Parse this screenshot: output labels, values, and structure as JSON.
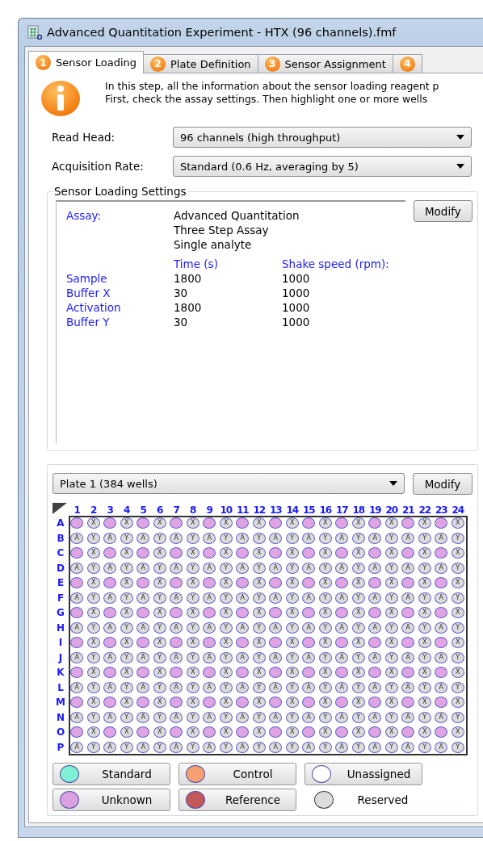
{
  "window": {
    "title": "Advanced Quantitation Experiment - HTX (96 channels).fmf"
  },
  "tabs": [
    {
      "number": "1",
      "label": "Sensor Loading",
      "selected": true
    },
    {
      "number": "2",
      "label": "Plate Definition",
      "selected": false
    },
    {
      "number": "3",
      "label": "Sensor Assignment",
      "selected": false
    },
    {
      "number": "4",
      "selected": false
    }
  ],
  "info": {
    "lines": [
      "In this step, all the information about the sensor loading reagent p",
      "First, check the assay settings. Then highlight one or more wells"
    ]
  },
  "settings": [
    {
      "label": "Read Head:",
      "value": "96 channels (high throughput)"
    },
    {
      "label": "Acquisition Rate:",
      "value": "Standard (0.6 Hz, averaging by 5)"
    }
  ],
  "sensor_loading_settings": {
    "title": "Sensor Loading Settings",
    "assay_label": "Assay:",
    "assay_lines": [
      "Advanced Quantitation",
      "Three Step Assay",
      "Single analyte"
    ],
    "columns": [
      "Time (s)",
      "Shake speed (rpm):"
    ],
    "steps": [
      {
        "name": "Sample",
        "time": "1800",
        "shake": "1000"
      },
      {
        "name": "Buffer X",
        "time": "30",
        "shake": "1000"
      },
      {
        "name": "Activation",
        "time": "1800",
        "shake": "1000"
      },
      {
        "name": "Buffer Y",
        "time": "30",
        "shake": "1000"
      }
    ],
    "button": "Modify"
  },
  "plate": {
    "selector": "Plate 1 (384 wells)",
    "button": "Modify",
    "columns": [
      "1",
      "2",
      "3",
      "4",
      "5",
      "6",
      "7",
      "8",
      "9",
      "10",
      "11",
      "12",
      "13",
      "14",
      "15",
      "16",
      "17",
      "18",
      "19",
      "20",
      "21",
      "22",
      "23",
      "24"
    ],
    "rows": [
      {
        "label": "A",
        "wells": [
          {
            "kind": "unknown"
          },
          {
            "kind": "reserved",
            "label": "X"
          },
          {
            "kind": "unknown"
          },
          {
            "kind": "reserved",
            "label": "X"
          },
          {
            "kind": "unknown"
          },
          {
            "kind": "reserved",
            "label": "X"
          },
          {
            "kind": "unknown"
          },
          {
            "kind": "reserved",
            "label": "X"
          },
          {
            "kind": "unknown"
          },
          {
            "kind": "reserved",
            "label": "X"
          },
          {
            "kind": "unknown"
          },
          {
            "kind": "reserved",
            "label": "X"
          },
          {
            "kind": "unknown"
          },
          {
            "kind": "reserved",
            "label": "X"
          },
          {
            "kind": "unknown"
          },
          {
            "kind": "reserved",
            "label": "X"
          },
          {
            "kind": "unknown"
          },
          {
            "kind": "reserved",
            "label": "X"
          },
          {
            "kind": "unknown"
          },
          {
            "kind": "reserved",
            "label": "X"
          },
          {
            "kind": "unknown"
          },
          {
            "kind": "reserved",
            "label": "X"
          },
          {
            "kind": "unknown"
          },
          {
            "kind": "reserved",
            "label": "X"
          }
        ]
      },
      {
        "label": "B",
        "wells": [
          {
            "kind": "reserved",
            "label": "A"
          },
          {
            "kind": "reserved",
            "label": "Y"
          },
          {
            "kind": "reserved",
            "label": "A"
          },
          {
            "kind": "reserved",
            "label": "Y"
          },
          {
            "kind": "reserved",
            "label": "A"
          },
          {
            "kind": "reserved",
            "label": "Y"
          },
          {
            "kind": "reserved",
            "label": "A"
          },
          {
            "kind": "reserved",
            "label": "Y"
          },
          {
            "kind": "reserved",
            "label": "A"
          },
          {
            "kind": "reserved",
            "label": "Y"
          },
          {
            "kind": "reserved",
            "label": "A"
          },
          {
            "kind": "reserved",
            "label": "Y"
          },
          {
            "kind": "reserved",
            "label": "A"
          },
          {
            "kind": "reserved",
            "label": "Y"
          },
          {
            "kind": "reserved",
            "label": "A"
          },
          {
            "kind": "reserved",
            "label": "Y"
          },
          {
            "kind": "reserved",
            "label": "A"
          },
          {
            "kind": "reserved",
            "label": "Y"
          },
          {
            "kind": "reserved",
            "label": "A"
          },
          {
            "kind": "reserved",
            "label": "Y"
          },
          {
            "kind": "reserved",
            "label": "A"
          },
          {
            "kind": "reserved",
            "label": "Y"
          },
          {
            "kind": "reserved",
            "label": "A"
          },
          {
            "kind": "reserved",
            "label": "Y"
          }
        ]
      },
      {
        "label": "C",
        "wells": [
          {
            "kind": "unknown"
          },
          {
            "kind": "reserved",
            "label": "X"
          },
          {
            "kind": "unknown"
          },
          {
            "kind": "reserved",
            "label": "X"
          },
          {
            "kind": "unknown"
          },
          {
            "kind": "reserved",
            "label": "X"
          },
          {
            "kind": "unknown"
          },
          {
            "kind": "reserved",
            "label": "X"
          },
          {
            "kind": "unknown"
          },
          {
            "kind": "reserved",
            "label": "X"
          },
          {
            "kind": "unknown"
          },
          {
            "kind": "reserved",
            "label": "X"
          },
          {
            "kind": "unknown"
          },
          {
            "kind": "reserved",
            "label": "X"
          },
          {
            "kind": "unknown"
          },
          {
            "kind": "reserved",
            "label": "X"
          },
          {
            "kind": "unknown"
          },
          {
            "kind": "reserved",
            "label": "X"
          },
          {
            "kind": "unknown"
          },
          {
            "kind": "reserved",
            "label": "X"
          },
          {
            "kind": "unknown"
          },
          {
            "kind": "reserved",
            "label": "X"
          },
          {
            "kind": "unknown"
          },
          {
            "kind": "reserved",
            "label": "X"
          }
        ]
      },
      {
        "label": "D",
        "wells": [
          {
            "kind": "reserved",
            "label": "A"
          },
          {
            "kind": "reserved",
            "label": "Y"
          },
          {
            "kind": "reserved",
            "label": "A"
          },
          {
            "kind": "reserved",
            "label": "Y"
          },
          {
            "kind": "reserved",
            "label": "A"
          },
          {
            "kind": "reserved",
            "label": "Y"
          },
          {
            "kind": "reserved",
            "label": "A"
          },
          {
            "kind": "reserved",
            "label": "Y"
          },
          {
            "kind": "reserved",
            "label": "A"
          },
          {
            "kind": "reserved",
            "label": "Y"
          },
          {
            "kind": "reserved",
            "label": "A"
          },
          {
            "kind": "reserved",
            "label": "Y"
          },
          {
            "kind": "reserved",
            "label": "A"
          },
          {
            "kind": "reserved",
            "label": "Y"
          },
          {
            "kind": "reserved",
            "label": "A"
          },
          {
            "kind": "reserved",
            "label": "Y"
          },
          {
            "kind": "reserved",
            "label": "A"
          },
          {
            "kind": "reserved",
            "label": "Y"
          },
          {
            "kind": "reserved",
            "label": "A"
          },
          {
            "kind": "reserved",
            "label": "Y"
          },
          {
            "kind": "reserved",
            "label": "A"
          },
          {
            "kind": "reserved",
            "label": "Y"
          },
          {
            "kind": "reserved",
            "label": "A"
          },
          {
            "kind": "reserved",
            "label": "Y"
          }
        ]
      },
      {
        "label": "E",
        "wells": [
          {
            "kind": "unknown"
          },
          {
            "kind": "reserved",
            "label": "X"
          },
          {
            "kind": "unknown"
          },
          {
            "kind": "reserved",
            "label": "X"
          },
          {
            "kind": "unknown"
          },
          {
            "kind": "reserved",
            "label": "X"
          },
          {
            "kind": "unknown"
          },
          {
            "kind": "reserved",
            "label": "X"
          },
          {
            "kind": "unknown"
          },
          {
            "kind": "reserved",
            "label": "X"
          },
          {
            "kind": "unknown"
          },
          {
            "kind": "reserved",
            "label": "X"
          },
          {
            "kind": "unknown"
          },
          {
            "kind": "reserved",
            "label": "X"
          },
          {
            "kind": "unknown"
          },
          {
            "kind": "reserved",
            "label": "X"
          },
          {
            "kind": "unknown"
          },
          {
            "kind": "reserved",
            "label": "X"
          },
          {
            "kind": "unknown"
          },
          {
            "kind": "reserved",
            "label": "X"
          },
          {
            "kind": "unknown"
          },
          {
            "kind": "reserved",
            "label": "X"
          },
          {
            "kind": "unknown"
          },
          {
            "kind": "reserved",
            "label": "X"
          }
        ]
      },
      {
        "label": "F",
        "wells": [
          {
            "kind": "reserved",
            "label": "A"
          },
          {
            "kind": "reserved",
            "label": "Y"
          },
          {
            "kind": "reserved",
            "label": "A"
          },
          {
            "kind": "reserved",
            "label": "Y"
          },
          {
            "kind": "reserved",
            "label": "A"
          },
          {
            "kind": "reserved",
            "label": "Y"
          },
          {
            "kind": "reserved",
            "label": "A"
          },
          {
            "kind": "reserved",
            "label": "Y"
          },
          {
            "kind": "reserved",
            "label": "A"
          },
          {
            "kind": "reserved",
            "label": "Y"
          },
          {
            "kind": "reserved",
            "label": "A"
          },
          {
            "kind": "reserved",
            "label": "Y"
          },
          {
            "kind": "reserved",
            "label": "A"
          },
          {
            "kind": "reserved",
            "label": "Y"
          },
          {
            "kind": "reserved",
            "label": "A"
          },
          {
            "kind": "reserved",
            "label": "Y"
          },
          {
            "kind": "reserved",
            "label": "A"
          },
          {
            "kind": "reserved",
            "label": "Y"
          },
          {
            "kind": "reserved",
            "label": "A"
          },
          {
            "kind": "reserved",
            "label": "Y"
          },
          {
            "kind": "reserved",
            "label": "A"
          },
          {
            "kind": "reserved",
            "label": "Y"
          },
          {
            "kind": "reserved",
            "label": "A"
          },
          {
            "kind": "reserved",
            "label": "Y"
          }
        ]
      },
      {
        "label": "G",
        "wells": [
          {
            "kind": "unknown"
          },
          {
            "kind": "reserved",
            "label": "X"
          },
          {
            "kind": "unknown"
          },
          {
            "kind": "reserved",
            "label": "X"
          },
          {
            "kind": "unknown"
          },
          {
            "kind": "reserved",
            "label": "X"
          },
          {
            "kind": "unknown"
          },
          {
            "kind": "reserved",
            "label": "X"
          },
          {
            "kind": "unknown"
          },
          {
            "kind": "reserved",
            "label": "X"
          },
          {
            "kind": "unknown"
          },
          {
            "kind": "reserved",
            "label": "X"
          },
          {
            "kind": "unknown"
          },
          {
            "kind": "reserved",
            "label": "X"
          },
          {
            "kind": "unknown"
          },
          {
            "kind": "reserved",
            "label": "X"
          },
          {
            "kind": "unknown"
          },
          {
            "kind": "reserved",
            "label": "X"
          },
          {
            "kind": "unknown"
          },
          {
            "kind": "reserved",
            "label": "X"
          },
          {
            "kind": "unknown"
          },
          {
            "kind": "reserved",
            "label": "X"
          },
          {
            "kind": "unknown"
          },
          {
            "kind": "reserved",
            "label": "X"
          }
        ]
      },
      {
        "label": "H",
        "wells": [
          {
            "kind": "reserved",
            "label": "A"
          },
          {
            "kind": "reserved",
            "label": "Y"
          },
          {
            "kind": "reserved",
            "label": "A"
          },
          {
            "kind": "reserved",
            "label": "Y"
          },
          {
            "kind": "reserved",
            "label": "A"
          },
          {
            "kind": "reserved",
            "label": "Y"
          },
          {
            "kind": "reserved",
            "label": "A"
          },
          {
            "kind": "reserved",
            "label": "Y"
          },
          {
            "kind": "reserved",
            "label": "A"
          },
          {
            "kind": "reserved",
            "label": "Y"
          },
          {
            "kind": "reserved",
            "label": "A"
          },
          {
            "kind": "reserved",
            "label": "Y"
          },
          {
            "kind": "reserved",
            "label": "A"
          },
          {
            "kind": "reserved",
            "label": "Y"
          },
          {
            "kind": "reserved",
            "label": "A"
          },
          {
            "kind": "reserved",
            "label": "Y"
          },
          {
            "kind": "reserved",
            "label": "A"
          },
          {
            "kind": "reserved",
            "label": "Y"
          },
          {
            "kind": "reserved",
            "label": "A"
          },
          {
            "kind": "reserved",
            "label": "Y"
          },
          {
            "kind": "reserved",
            "label": "A"
          },
          {
            "kind": "reserved",
            "label": "Y"
          },
          {
            "kind": "reserved",
            "label": "A"
          },
          {
            "kind": "reserved",
            "label": "Y"
          }
        ]
      },
      {
        "label": "I",
        "wells": [
          {
            "kind": "unknown"
          },
          {
            "kind": "reserved",
            "label": "X"
          },
          {
            "kind": "unknown"
          },
          {
            "kind": "reserved",
            "label": "X"
          },
          {
            "kind": "unknown"
          },
          {
            "kind": "reserved",
            "label": "X"
          },
          {
            "kind": "unknown"
          },
          {
            "kind": "reserved",
            "label": "X"
          },
          {
            "kind": "unknown"
          },
          {
            "kind": "reserved",
            "label": "X"
          },
          {
            "kind": "unknown"
          },
          {
            "kind": "reserved",
            "label": "X"
          },
          {
            "kind": "unknown"
          },
          {
            "kind": "reserved",
            "label": "X"
          },
          {
            "kind": "unknown"
          },
          {
            "kind": "reserved",
            "label": "X"
          },
          {
            "kind": "unknown"
          },
          {
            "kind": "reserved",
            "label": "X"
          },
          {
            "kind": "unknown"
          },
          {
            "kind": "reserved",
            "label": "X"
          },
          {
            "kind": "unknown"
          },
          {
            "kind": "reserved",
            "label": "X"
          },
          {
            "kind": "unknown"
          },
          {
            "kind": "reserved",
            "label": "X"
          }
        ]
      },
      {
        "label": "J",
        "wells": [
          {
            "kind": "reserved",
            "label": "A"
          },
          {
            "kind": "reserved",
            "label": "Y"
          },
          {
            "kind": "reserved",
            "label": "A"
          },
          {
            "kind": "reserved",
            "label": "Y"
          },
          {
            "kind": "reserved",
            "label": "A"
          },
          {
            "kind": "reserved",
            "label": "Y"
          },
          {
            "kind": "reserved",
            "label": "A"
          },
          {
            "kind": "reserved",
            "label": "Y"
          },
          {
            "kind": "reserved",
            "label": "A"
          },
          {
            "kind": "reserved",
            "label": "Y"
          },
          {
            "kind": "reserved",
            "label": "A"
          },
          {
            "kind": "reserved",
            "label": "Y"
          },
          {
            "kind": "reserved",
            "label": "A"
          },
          {
            "kind": "reserved",
            "label": "Y"
          },
          {
            "kind": "reserved",
            "label": "A"
          },
          {
            "kind": "reserved",
            "label": "Y"
          },
          {
            "kind": "reserved",
            "label": "A"
          },
          {
            "kind": "reserved",
            "label": "Y"
          },
          {
            "kind": "reserved",
            "label": "A"
          },
          {
            "kind": "reserved",
            "label": "Y"
          },
          {
            "kind": "reserved",
            "label": "A"
          },
          {
            "kind": "reserved",
            "label": "Y"
          },
          {
            "kind": "reserved",
            "label": "A"
          },
          {
            "kind": "reserved",
            "label": "Y"
          }
        ]
      },
      {
        "label": "K",
        "wells": [
          {
            "kind": "unknown"
          },
          {
            "kind": "reserved",
            "label": "X"
          },
          {
            "kind": "unknown"
          },
          {
            "kind": "reserved",
            "label": "X"
          },
          {
            "kind": "unknown"
          },
          {
            "kind": "reserved",
            "label": "X"
          },
          {
            "kind": "unknown"
          },
          {
            "kind": "reserved",
            "label": "X"
          },
          {
            "kind": "unknown"
          },
          {
            "kind": "reserved",
            "label": "X"
          },
          {
            "kind": "unknown"
          },
          {
            "kind": "reserved",
            "label": "X"
          },
          {
            "kind": "unknown"
          },
          {
            "kind": "reserved",
            "label": "X"
          },
          {
            "kind": "unknown"
          },
          {
            "kind": "reserved",
            "label": "X"
          },
          {
            "kind": "unknown"
          },
          {
            "kind": "reserved",
            "label": "X"
          },
          {
            "kind": "unknown"
          },
          {
            "kind": "reserved",
            "label": "X"
          },
          {
            "kind": "unknown"
          },
          {
            "kind": "reserved",
            "label": "X"
          },
          {
            "kind": "unknown"
          },
          {
            "kind": "reserved",
            "label": "X"
          }
        ]
      },
      {
        "label": "L",
        "wells": [
          {
            "kind": "reserved",
            "label": "A"
          },
          {
            "kind": "reserved",
            "label": "Y"
          },
          {
            "kind": "reserved",
            "label": "A"
          },
          {
            "kind": "reserved",
            "label": "Y"
          },
          {
            "kind": "reserved",
            "label": "A"
          },
          {
            "kind": "reserved",
            "label": "Y"
          },
          {
            "kind": "reserved",
            "label": "A"
          },
          {
            "kind": "reserved",
            "label": "Y"
          },
          {
            "kind": "reserved",
            "label": "A"
          },
          {
            "kind": "reserved",
            "label": "Y"
          },
          {
            "kind": "reserved",
            "label": "A"
          },
          {
            "kind": "reserved",
            "label": "Y"
          },
          {
            "kind": "reserved",
            "label": "A"
          },
          {
            "kind": "reserved",
            "label": "Y"
          },
          {
            "kind": "reserved",
            "label": "A"
          },
          {
            "kind": "reserved",
            "label": "Y"
          },
          {
            "kind": "reserved",
            "label": "A"
          },
          {
            "kind": "reserved",
            "label": "Y"
          },
          {
            "kind": "reserved",
            "label": "A"
          },
          {
            "kind": "reserved",
            "label": "Y"
          },
          {
            "kind": "reserved",
            "label": "A"
          },
          {
            "kind": "reserved",
            "label": "Y"
          },
          {
            "kind": "reserved",
            "label": "A"
          },
          {
            "kind": "reserved",
            "label": "Y"
          }
        ]
      },
      {
        "label": "M",
        "wells": [
          {
            "kind": "unknown"
          },
          {
            "kind": "reserved",
            "label": "X"
          },
          {
            "kind": "unknown"
          },
          {
            "kind": "reserved",
            "label": "X"
          },
          {
            "kind": "unknown"
          },
          {
            "kind": "reserved",
            "label": "X"
          },
          {
            "kind": "unknown"
          },
          {
            "kind": "reserved",
            "label": "X"
          },
          {
            "kind": "unknown"
          },
          {
            "kind": "reserved",
            "label": "X"
          },
          {
            "kind": "unknown"
          },
          {
            "kind": "reserved",
            "label": "X"
          },
          {
            "kind": "unknown"
          },
          {
            "kind": "reserved",
            "label": "X"
          },
          {
            "kind": "unknown"
          },
          {
            "kind": "reserved",
            "label": "X"
          },
          {
            "kind": "unknown"
          },
          {
            "kind": "reserved",
            "label": "X"
          },
          {
            "kind": "unknown"
          },
          {
            "kind": "reserved",
            "label": "X"
          },
          {
            "kind": "unknown"
          },
          {
            "kind": "reserved",
            "label": "X"
          },
          {
            "kind": "unknown"
          },
          {
            "kind": "reserved",
            "label": "X"
          }
        ]
      },
      {
        "label": "N",
        "wells": [
          {
            "kind": "reserved",
            "label": "A"
          },
          {
            "kind": "reserved",
            "label": "Y"
          },
          {
            "kind": "reserved",
            "label": "A"
          },
          {
            "kind": "reserved",
            "label": "Y"
          },
          {
            "kind": "reserved",
            "label": "A"
          },
          {
            "kind": "reserved",
            "label": "Y"
          },
          {
            "kind": "reserved",
            "label": "A"
          },
          {
            "kind": "reserved",
            "label": "Y"
          },
          {
            "kind": "reserved",
            "label": "A"
          },
          {
            "kind": "reserved",
            "label": "Y"
          },
          {
            "kind": "reserved",
            "label": "A"
          },
          {
            "kind": "reserved",
            "label": "Y"
          },
          {
            "kind": "reserved",
            "label": "A"
          },
          {
            "kind": "reserved",
            "label": "Y"
          },
          {
            "kind": "reserved",
            "label": "A"
          },
          {
            "kind": "reserved",
            "label": "Y"
          },
          {
            "kind": "reserved",
            "label": "A"
          },
          {
            "kind": "reserved",
            "label": "Y"
          },
          {
            "kind": "reserved",
            "label": "A"
          },
          {
            "kind": "reserved",
            "label": "Y"
          },
          {
            "kind": "reserved",
            "label": "A"
          },
          {
            "kind": "reserved",
            "label": "Y"
          },
          {
            "kind": "reserved",
            "label": "A"
          },
          {
            "kind": "reserved",
            "label": "Y"
          }
        ]
      },
      {
        "label": "O",
        "wells": [
          {
            "kind": "unknown"
          },
          {
            "kind": "reserved",
            "label": "X"
          },
          {
            "kind": "unknown"
          },
          {
            "kind": "reserved",
            "label": "X"
          },
          {
            "kind": "unknown"
          },
          {
            "kind": "reserved",
            "label": "X"
          },
          {
            "kind": "unknown"
          },
          {
            "kind": "reserved",
            "label": "X"
          },
          {
            "kind": "unknown"
          },
          {
            "kind": "reserved",
            "label": "X"
          },
          {
            "kind": "unknown"
          },
          {
            "kind": "reserved",
            "label": "X"
          },
          {
            "kind": "unknown"
          },
          {
            "kind": "reserved",
            "label": "X"
          },
          {
            "kind": "unknown"
          },
          {
            "kind": "reserved",
            "label": "X"
          },
          {
            "kind": "unknown"
          },
          {
            "kind": "reserved",
            "label": "X"
          },
          {
            "kind": "unknown"
          },
          {
            "kind": "reserved",
            "label": "X"
          },
          {
            "kind": "unknown"
          },
          {
            "kind": "reserved",
            "label": "X"
          },
          {
            "kind": "unknown"
          },
          {
            "kind": "reserved",
            "label": "X"
          }
        ]
      },
      {
        "label": "P",
        "wells": [
          {
            "kind": "reserved",
            "label": "A"
          },
          {
            "kind": "reserved",
            "label": "Y"
          },
          {
            "kind": "reserved",
            "label": "A"
          },
          {
            "kind": "reserved",
            "label": "Y"
          },
          {
            "kind": "reserved",
            "label": "A"
          },
          {
            "kind": "reserved",
            "label": "Y"
          },
          {
            "kind": "reserved",
            "label": "A"
          },
          {
            "kind": "reserved",
            "label": "Y"
          },
          {
            "kind": "reserved",
            "label": "A"
          },
          {
            "kind": "reserved",
            "label": "Y"
          },
          {
            "kind": "reserved",
            "label": "A"
          },
          {
            "kind": "reserved",
            "label": "Y"
          },
          {
            "kind": "reserved",
            "label": "A"
          },
          {
            "kind": "reserved",
            "label": "Y"
          },
          {
            "kind": "reserved",
            "label": "A"
          },
          {
            "kind": "reserved",
            "label": "Y"
          },
          {
            "kind": "reserved",
            "label": "A"
          },
          {
            "kind": "reserved",
            "label": "Y"
          },
          {
            "kind": "reserved",
            "label": "A"
          },
          {
            "kind": "reserved",
            "label": "Y"
          },
          {
            "kind": "reserved",
            "label": "A"
          },
          {
            "kind": "reserved",
            "label": "Y"
          },
          {
            "kind": "reserved",
            "label": "A"
          },
          {
            "kind": "reserved",
            "label": "Y"
          }
        ]
      }
    ]
  },
  "legend": [
    {
      "label": "Standard",
      "color": "#7ff0d4",
      "kind": "button"
    },
    {
      "label": "Control",
      "color": "#f5a070",
      "kind": "button"
    },
    {
      "label": "Unassigned",
      "color": "#ffffff",
      "kind": "button"
    },
    {
      "label": "Unknown",
      "color": "#dca0e0",
      "kind": "button"
    },
    {
      "label": "Reference",
      "color": "#c45858",
      "kind": "button"
    },
    {
      "label": "Reserved",
      "color": "#dcdcdc",
      "kind": "plain"
    }
  ]
}
